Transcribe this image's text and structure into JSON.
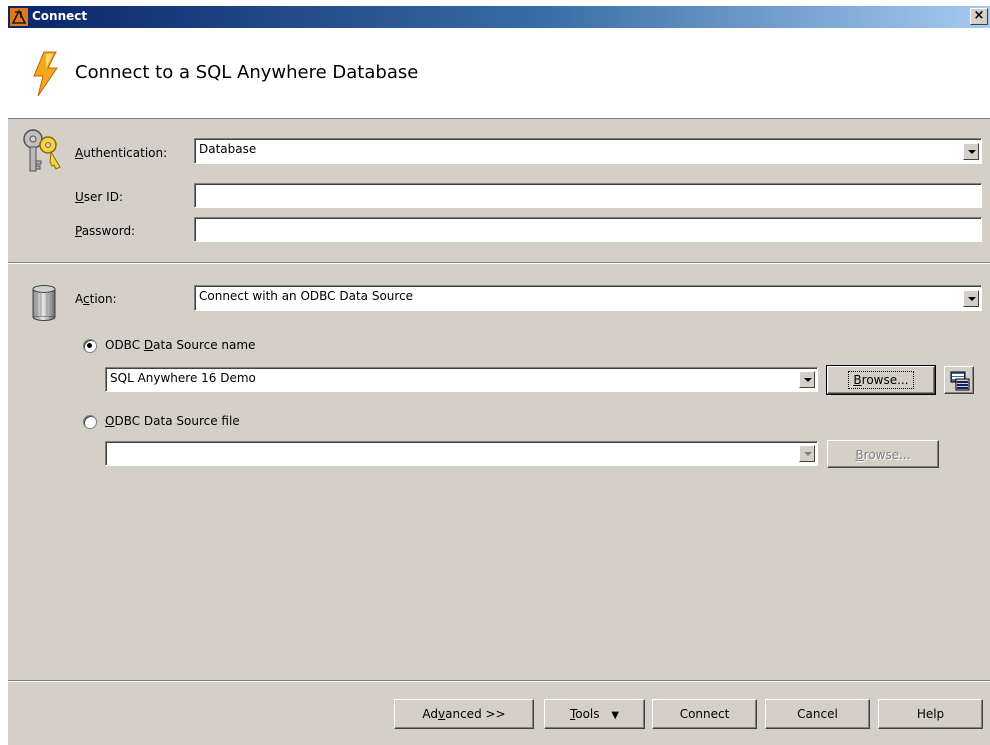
{
  "window": {
    "title": "Connect",
    "close_label": "×"
  },
  "header": {
    "title": "Connect to a SQL Anywhere Database"
  },
  "auth": {
    "authentication_label_u": "A",
    "authentication_label_rest": "uthentication:",
    "authentication_value": "Database",
    "userid_label_u": "U",
    "userid_label_rest": "ser ID:",
    "userid_value": "",
    "password_label_u": "P",
    "password_label_rest": "assword:",
    "password_value": ""
  },
  "action": {
    "label_pre": "A",
    "label_u": "c",
    "label_rest": "tion:",
    "value": "Connect with an ODBC Data Source"
  },
  "odbc_name": {
    "label_pre": "ODBC ",
    "label_u": "D",
    "label_rest": "ata Source name",
    "selected": true,
    "value": "SQL Anywhere 16 Demo",
    "browse_pre": "B",
    "browse_rest": "rowse..."
  },
  "odbc_file": {
    "label_u": "O",
    "label_rest": "DBC Data Source file",
    "selected": false,
    "value": "",
    "browse_pre": "B",
    "browse_rest": "rowse..."
  },
  "footer": {
    "advanced_pre": "Ad",
    "advanced_u": "v",
    "advanced_rest": "anced >>",
    "tools_u": "T",
    "tools_rest": "ools",
    "tools_arrow": "▼",
    "connect_label": "Connect",
    "cancel_label": "Cancel",
    "help_label": "Help"
  },
  "icons": [
    "app-icon",
    "lightning-bolt-icon",
    "keys-icon",
    "database-cylinder-icon",
    "odbc-admin-icon",
    "dropdown-arrow-icon"
  ]
}
